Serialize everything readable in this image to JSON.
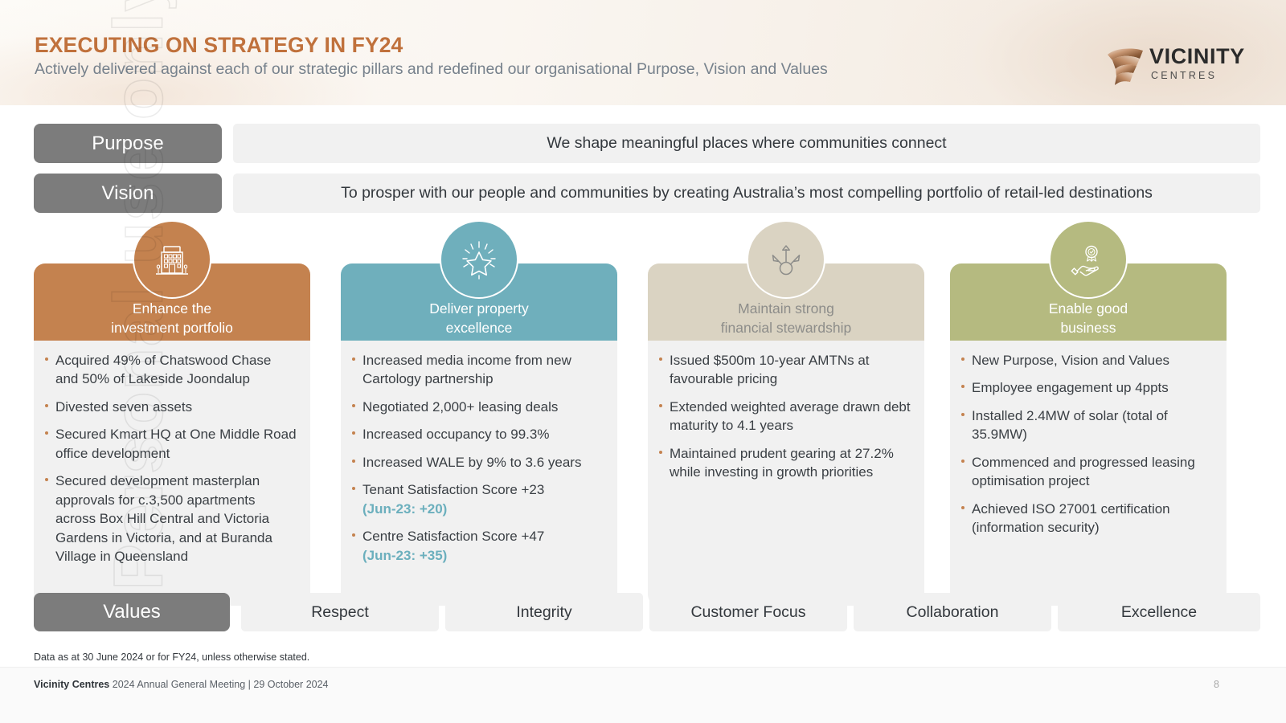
{
  "header": {
    "title": "EXECUTING ON STRATEGY IN FY24",
    "subtitle": "Actively delivered against each of our strategic pillars and redefined our organisational Purpose, Vision and Values",
    "logo_word": "VICINITY",
    "logo_sub": "CENTRES"
  },
  "watermark": "Personal use only",
  "purpose": {
    "label": "Purpose",
    "statement": "We shape meaningful places where communities connect"
  },
  "vision": {
    "label": "Vision",
    "statement": "To prosper with our people and communities by creating Australia’s most compelling portfolio of retail-led destinations"
  },
  "pillars": [
    {
      "title_line1": "Enhance the",
      "title_line2": "investment portfolio",
      "color": "#C4824F",
      "icon": "building-icon",
      "title_muted": false,
      "bullets": [
        {
          "text": "Acquired 49% of Chatswood Chase and 50% of Lakeside Joondalup"
        },
        {
          "text": "Divested seven assets"
        },
        {
          "text": "Secured Kmart HQ at One Middle Road office development"
        },
        {
          "text": "Secured development masterplan approvals for c.3,500 apartments across Box Hill Central and Victoria Gardens in Victoria, and at Buranda Village in Queensland"
        }
      ]
    },
    {
      "title_line1": "Deliver property",
      "title_line2": "excellence",
      "color": "#6FAFBC",
      "icon": "shining-star-icon",
      "title_muted": false,
      "bullets": [
        {
          "text": "Increased media income from new Cartology partnership"
        },
        {
          "text": "Negotiated 2,000+ leasing deals"
        },
        {
          "text": "Increased occupancy to 99.3%"
        },
        {
          "text": "Increased WALE by 9% to 3.6 years"
        },
        {
          "text": "Tenant Satisfaction Score +23",
          "note": "(Jun-23: +20)"
        },
        {
          "text": "Centre Satisfaction Score +47",
          "note": "(Jun-23: +35)"
        }
      ]
    },
    {
      "title_line1": "Maintain strong",
      "title_line2": "financial stewardship",
      "color": "#DAD3C2",
      "icon": "three-arrows-icon",
      "title_muted": true,
      "bullets": [
        {
          "text": "Issued $500m 10-year AMTNs at favourable pricing"
        },
        {
          "text": "Extended weighted average drawn debt maturity to 4.1 years"
        },
        {
          "text": "Maintained prudent gearing at 27.2% while investing in growth priorities"
        }
      ]
    },
    {
      "title_line1": "Enable good",
      "title_line2": "business",
      "color": "#B5BA80",
      "icon": "hand-award-icon",
      "title_muted": false,
      "bullets": [
        {
          "text": "New Purpose, Vision and Values"
        },
        {
          "text": "Employee engagement up 4ppts"
        },
        {
          "text": "Installed 2.4MW of solar (total of 35.9MW)"
        },
        {
          "text": "Commenced and progressed leasing optimisation project"
        },
        {
          "text": "Achieved ISO 27001 certification (information security)"
        }
      ]
    }
  ],
  "values": {
    "label": "Values",
    "items": [
      "Respect",
      "Integrity",
      "Customer Focus",
      "Collaboration",
      "Excellence"
    ]
  },
  "footer": {
    "footnote": "Data as at 30 June 2024 or for FY24, unless otherwise stated.",
    "brand_bold": "Vicinity Centres",
    "meeting": "2024 Annual General Meeting",
    "separator": "|",
    "date": "29 October 2024",
    "page_number": "8"
  }
}
